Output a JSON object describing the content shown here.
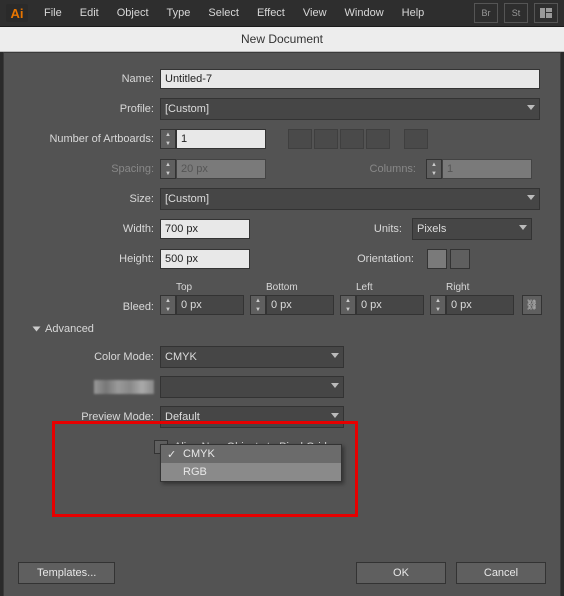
{
  "menubar": {
    "logo": "Ai",
    "items": [
      "File",
      "Edit",
      "Object",
      "Type",
      "Select",
      "Effect",
      "View",
      "Window",
      "Help"
    ],
    "right_icons": [
      "Br",
      "St",
      "layout"
    ]
  },
  "dialog": {
    "title": "New Document",
    "labels": {
      "name": "Name:",
      "profile": "Profile:",
      "num_artboards": "Number of Artboards:",
      "spacing": "Spacing:",
      "columns": "Columns:",
      "size": "Size:",
      "width": "Width:",
      "units": "Units:",
      "height": "Height:",
      "orientation": "Orientation:",
      "bleed": "Bleed:",
      "bleed_top": "Top",
      "bleed_bottom": "Bottom",
      "bleed_left": "Left",
      "bleed_right": "Right",
      "advanced": "Advanced",
      "color_mode": "Color Mode:",
      "preview_mode": "Preview Mode:",
      "align_pixel": "Align New Objects to Pixel Grid"
    },
    "values": {
      "name": "Untitled-7",
      "profile": "[Custom]",
      "num_artboards": "1",
      "spacing": "20 px",
      "columns": "1",
      "size": "[Custom]",
      "width": "700 px",
      "units": "Pixels",
      "height": "500 px",
      "bleed_top": "0 px",
      "bleed_bottom": "0 px",
      "bleed_left": "0 px",
      "bleed_right": "0 px",
      "color_mode": "CMYK",
      "preview_mode": "Default"
    },
    "color_mode_options": {
      "selected": "CMYK",
      "items": [
        "CMYK",
        "RGB"
      ],
      "highlighted_index": 1
    },
    "buttons": {
      "templates": "Templates...",
      "ok": "OK",
      "cancel": "Cancel"
    }
  }
}
